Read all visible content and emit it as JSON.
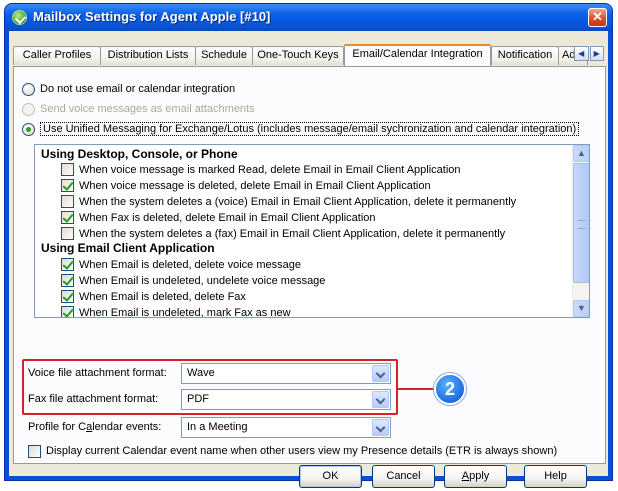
{
  "window": {
    "title": "Mailbox Settings for Agent Apple [#10]",
    "close_glyph": "✕"
  },
  "tabs": [
    {
      "label": "Caller Profiles"
    },
    {
      "label": "Distribution Lists"
    },
    {
      "label": "Schedule"
    },
    {
      "label": "One-Touch Keys"
    },
    {
      "label": "Email/Calendar Integration",
      "active": true
    },
    {
      "label": "Notification"
    },
    {
      "label": "Adv."
    }
  ],
  "tab_scroll": {
    "left": "◀",
    "right": "▶"
  },
  "integration_options": {
    "no_integration": "Do not use email or calendar integration",
    "send_attachments": "Send voice messages as email attachments",
    "unified_messaging": "Use Unified Messaging for Exchange/Lotus (includes message/email sychronization and calendar integration)"
  },
  "sync_list": {
    "group1_title": "Using Desktop, Console, or Phone",
    "group1_items": [
      {
        "label": "When voice message is marked Read, delete Email in Email Client Application",
        "checked": false
      },
      {
        "label": "When voice message is deleted, delete Email in Email Client Application",
        "checked": true
      },
      {
        "label": "When the system deletes a (voice) Email in Email Client Application, delete it permanently",
        "checked": false
      },
      {
        "label": "When Fax is deleted, delete Email in Email Client Application",
        "checked": true
      },
      {
        "label": "When the system deletes a (fax) Email in Email Client Application, delete it permanently",
        "checked": false
      }
    ],
    "group2_title": "Using Email Client Application",
    "group2_items": [
      {
        "label": "When Email is deleted, delete voice message",
        "checked": true
      },
      {
        "label": "When Email is undeleted, undelete voice message",
        "checked": true
      },
      {
        "label": "When Email is deleted, delete Fax",
        "checked": true
      },
      {
        "label": "When Email is undeleted, mark Fax as new",
        "checked": true
      }
    ],
    "scroll_up": "▲",
    "scroll_down": "▼"
  },
  "voice_format": {
    "label": "Voice file attachment format:",
    "value": "Wave"
  },
  "fax_format": {
    "label": "Fax file attachment format:",
    "value": "PDF"
  },
  "calendar_profile": {
    "label_pre": "Profile for C",
    "label_u": "a",
    "label_post": "lendar events:",
    "value": "In a Meeting"
  },
  "display_event": {
    "label": "Display current Calendar event name when other users view my Presence details (ETR is always shown)",
    "checked": false
  },
  "callout_badge": "2",
  "buttons": {
    "ok": "OK",
    "cancel": "Cancel",
    "apply_u": "A",
    "apply_rest": "pply",
    "help": "Help"
  }
}
